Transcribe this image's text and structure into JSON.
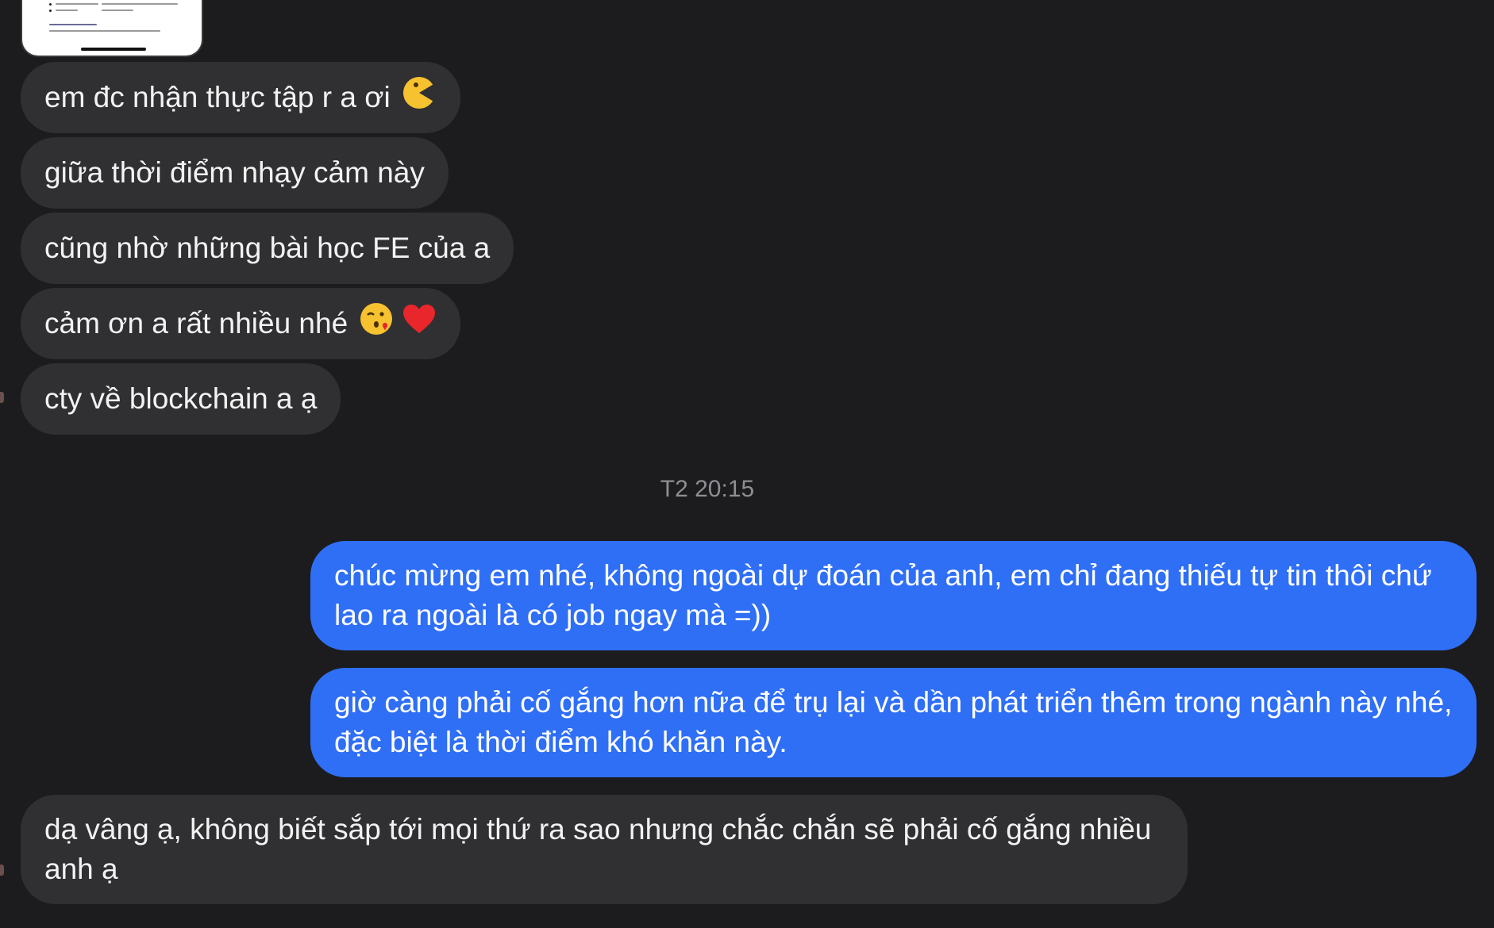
{
  "conversation": {
    "attachment": {
      "description": "document-screenshot"
    },
    "received_1": [
      {
        "text": "em đc nhận thực tập r a ơi",
        "emoji": "pacman-laugh-emoji"
      },
      {
        "text": "giữa thời điểm nhạy cảm này"
      },
      {
        "text": "cũng nhờ những bài học FE của a"
      },
      {
        "text": "cảm ơn a rất nhiều nhé",
        "emoji": "kissing-heart-emoji, red-heart-emoji"
      },
      {
        "text": "cty về blockchain a ạ"
      }
    ],
    "timestamp": "T2 20:15",
    "sent": [
      {
        "text": "chúc mừng em nhé, không ngoài dự đoán của anh, em chỉ đang thiếu tự tin thôi chứ lao ra ngoài là có job ngay mà =))"
      },
      {
        "text": "giờ càng phải cố gắng hơn nữa để trụ lại và dần phát triển thêm trong ngành này nhé, đặc biệt là thời điểm khó khăn này."
      }
    ],
    "received_2": [
      {
        "text": "dạ vâng ạ, không biết sắp tới mọi thứ ra sao nhưng chắc chắn sẽ phải cố gắng nhiều anh ạ"
      }
    ]
  },
  "colors": {
    "background": "#1c1c1e",
    "received_bubble": "#303033",
    "sent_bubble": "#2f6ff6",
    "timestamp": "#8e8e93"
  }
}
